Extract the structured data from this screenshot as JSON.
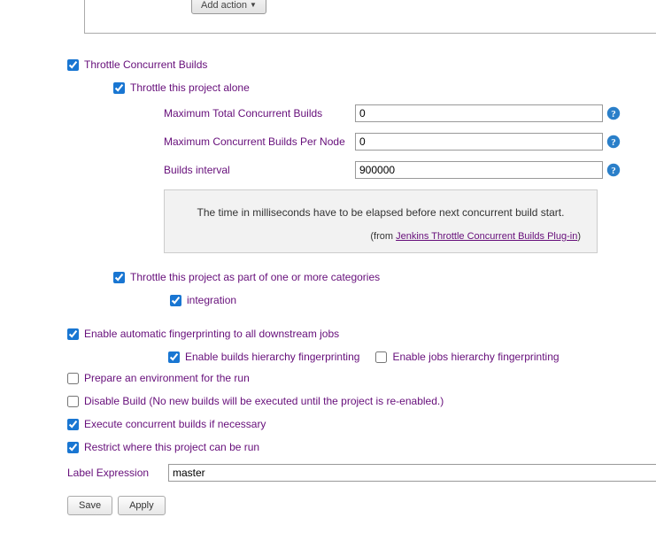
{
  "topButton": {
    "label": "Add action"
  },
  "throttle": {
    "label": "Throttle Concurrent Builds",
    "alone": {
      "label": "Throttle this project alone",
      "maxTotal": {
        "label": "Maximum Total Concurrent Builds",
        "value": "0"
      },
      "maxPerNode": {
        "label": "Maximum Concurrent Builds Per Node",
        "value": "0"
      },
      "interval": {
        "label": "Builds interval",
        "value": "900000"
      },
      "helpText": "The time in milliseconds have to be elapsed before next concurrent build start.",
      "helpFrom": "(from ",
      "helpLink": "Jenkins Throttle Concurrent Builds Plug-in",
      "helpClose": ")"
    },
    "categories": {
      "label": "Throttle this project as part of one or more categories",
      "item": "integration"
    }
  },
  "fingerprint": {
    "label": "Enable automatic fingerprinting to all downstream jobs",
    "builds": "Enable builds hierarchy fingerprinting",
    "jobs": "Enable jobs hierarchy fingerprinting"
  },
  "prepareEnv": "Prepare an environment for the run",
  "disableBuild": "Disable Build (No new builds will be executed until the project is re-enabled.)",
  "execConcurrent": "Execute concurrent builds if necessary",
  "restrict": {
    "label": "Restrict where this project can be run",
    "exprLabel": "Label Expression",
    "exprValue": "master"
  },
  "buttons": {
    "save": "Save",
    "apply": "Apply"
  }
}
